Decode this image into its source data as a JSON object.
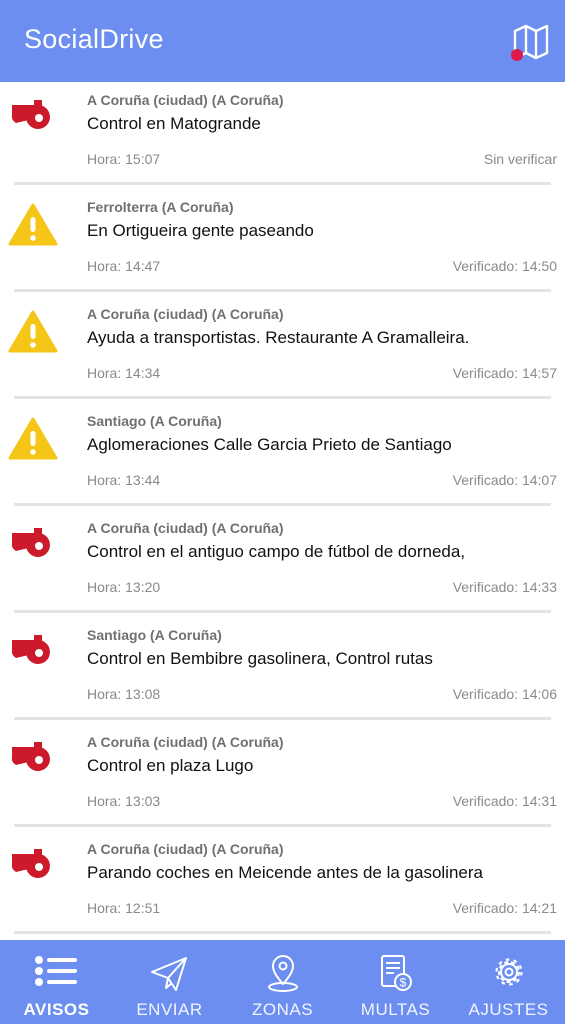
{
  "app": {
    "title": "SocialDrive"
  },
  "colors": {
    "primary": "#6b8ef0",
    "alert_red": "#cc1a2a",
    "warning_yellow": "#f5c518"
  },
  "feed": {
    "items": [
      {
        "icon": "whistle-icon",
        "region": "A Coruña (ciudad) (A Coruña)",
        "message": "Control en Matogrande",
        "time": "Hora: 15:07",
        "status": "Sin verificar"
      },
      {
        "icon": "warning-icon",
        "region": "Ferrolterra (A Coruña)",
        "message": "En Ortigueira gente paseando",
        "time": "Hora: 14:47",
        "status": "Verificado: 14:50"
      },
      {
        "icon": "warning-icon",
        "region": "A Coruña (ciudad) (A Coruña)",
        "message": "Ayuda a transportistas. Restaurante A Gramalleira.",
        "time": "Hora: 14:34",
        "status": "Verificado: 14:57"
      },
      {
        "icon": "warning-icon",
        "region": "Santiago (A Coruña)",
        "message": "Aglomeraciones Calle Garcia Prieto de Santiago",
        "time": "Hora: 13:44",
        "status": "Verificado: 14:07"
      },
      {
        "icon": "whistle-icon",
        "region": "A Coruña (ciudad) (A Coruña)",
        "message": "Control en el antiguo campo de fútbol de dorneda,",
        "time": "Hora: 13:20",
        "status": "Verificado: 14:33"
      },
      {
        "icon": "whistle-icon",
        "region": "Santiago (A Coruña)",
        "message": "Control en Bembibre gasolinera, Control rutas",
        "time": "Hora: 13:08",
        "status": "Verificado: 14:06"
      },
      {
        "icon": "whistle-icon",
        "region": "A Coruña (ciudad) (A Coruña)",
        "message": "Control en plaza Lugo",
        "time": "Hora: 13:03",
        "status": "Verificado: 14:31"
      },
      {
        "icon": "whistle-icon",
        "region": "A Coruña (ciudad) (A Coruña)",
        "message": "Parando coches en Meicende antes de la gasolinera",
        "time": "Hora: 12:51",
        "status": "Verificado: 14:21"
      }
    ]
  },
  "nav": {
    "items": [
      {
        "label": "AVISOS",
        "icon": "list-icon",
        "active": true
      },
      {
        "label": "ENVIAR",
        "icon": "send-icon",
        "active": false
      },
      {
        "label": "ZONAS",
        "icon": "location-pin-icon",
        "active": false
      },
      {
        "label": "MULTAS",
        "icon": "fine-document-icon",
        "active": false
      },
      {
        "label": "AJUSTES",
        "icon": "gear-icon",
        "active": false
      }
    ]
  }
}
